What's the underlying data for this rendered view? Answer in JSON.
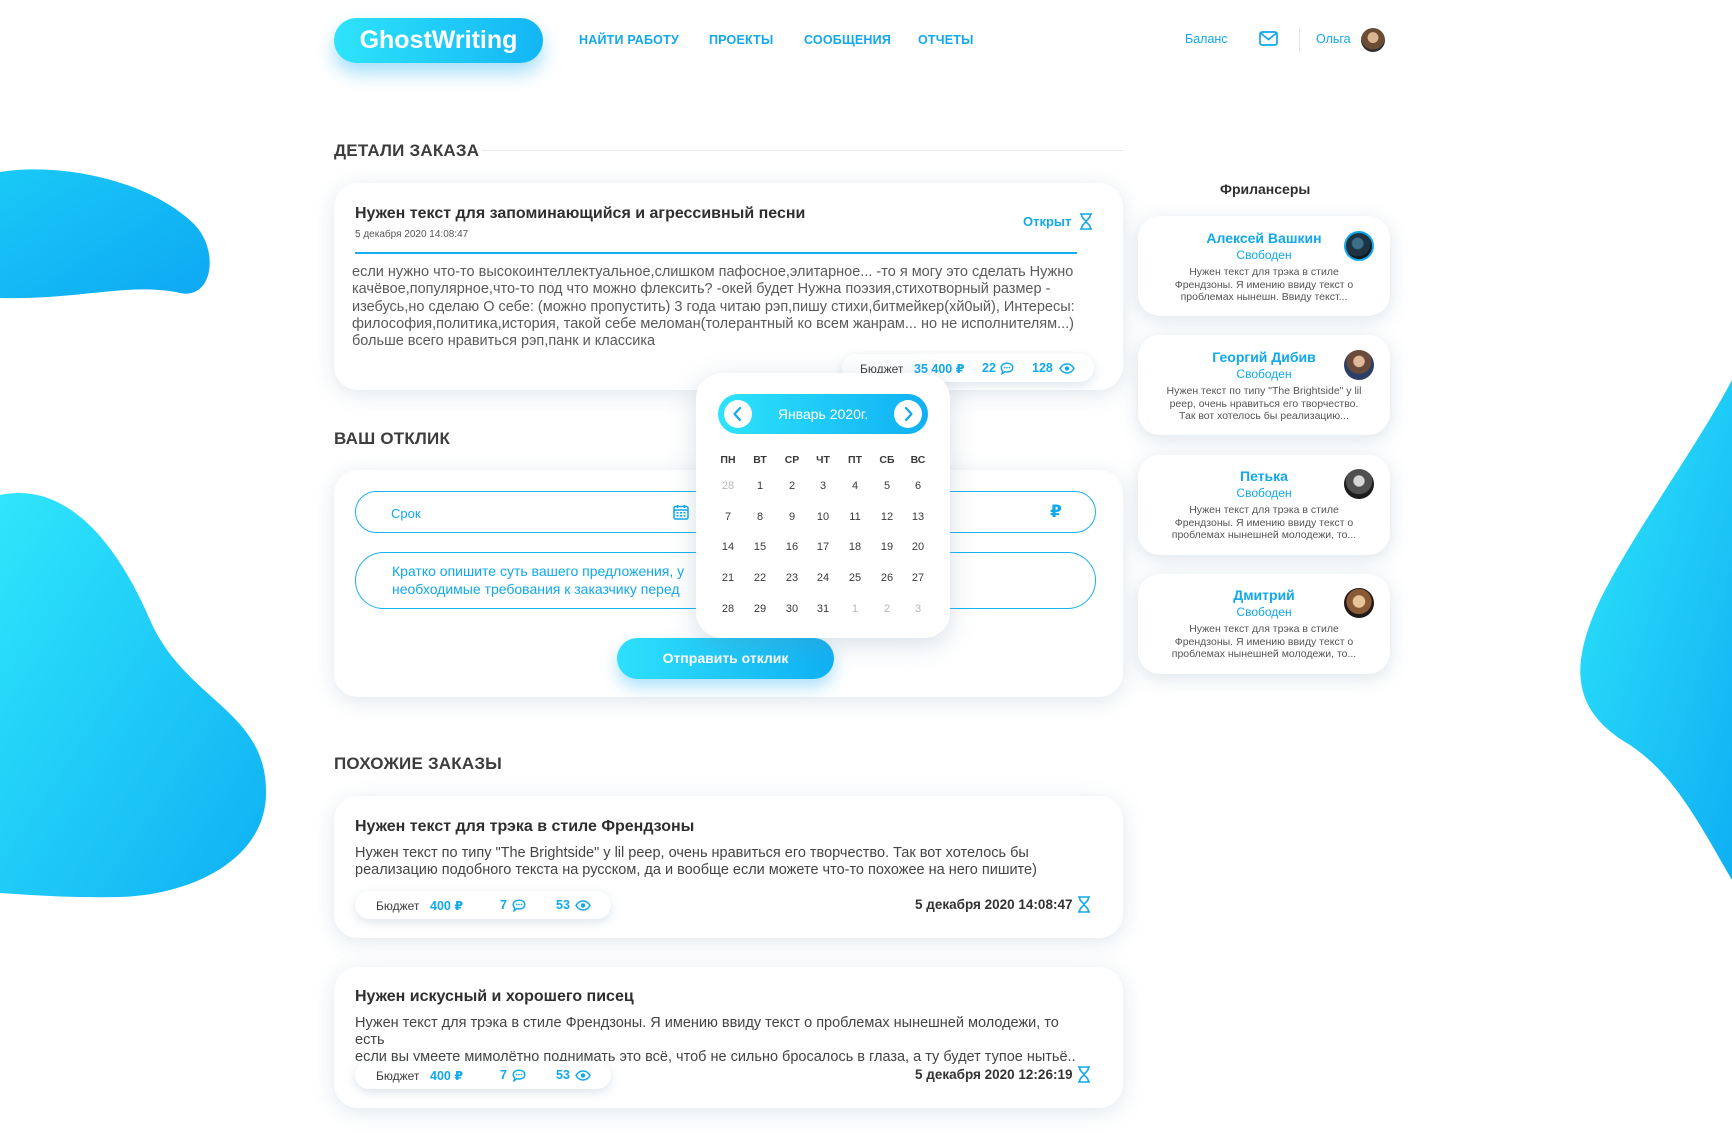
{
  "brand": {
    "name": "GhostWriting"
  },
  "nav": [
    "НАЙТИ РАБОТУ",
    "ПРОЕКТЫ",
    "СООБЩЕНИЯ",
    "ОТЧЕТЫ"
  ],
  "user": {
    "balance_label": "Баланс",
    "name": "Ольга"
  },
  "colors": {
    "accent": "#11a8ec",
    "gradient_start": "#2ee3fb",
    "gradient_end": "#0fb0f3"
  },
  "order": {
    "section_title": "ДЕТАЛИ ЗАКАЗА",
    "title": "Нужен текст для запоминающийся и агрессивный песни",
    "date": "5 декабря 2020 14:08:47",
    "status": "Открыт",
    "description_lines": [
      "если нужно что-то высокоинтеллектуальное,слишком пафосное,элитарное... -то я могу это сделать Нужно",
      "качёвое,популярное,что-то под что можно флексить? -окей будет Нужна поэзия,стихотворный размер -",
      "изебусь,но сделаю О себе: (можно пропустить) 3 года читаю рэп,пишу стихи,битмейкер(хй0ый), Интересы:",
      "философия,политика,история, такой себе меломан(толерантный ко всем жанрам... но не исполнителям...)",
      "больше всего нравиться рэп,панк и классика"
    ],
    "budget_label": "Бюджет",
    "budget": "35 400 ₽",
    "comments": "22",
    "views": "128"
  },
  "response": {
    "section_title": "ВАШ ОТКЛИК",
    "deadline_placeholder": "Срок",
    "currency": "₽",
    "message_lines": [
      "Кратко опишите суть вашего предложения, у",
      "необходимые требования к заказчику перед"
    ],
    "submit": "Отправить отклик"
  },
  "calendar": {
    "month": "Январь 2020г.",
    "weekdays": [
      "ПН",
      "ВТ",
      "СР",
      "ЧТ",
      "ПТ",
      "СБ",
      "ВС"
    ],
    "weeks": [
      [
        "28",
        "1",
        "2",
        "3",
        "4",
        "5",
        "6"
      ],
      [
        "7",
        "8",
        "9",
        "10",
        "11",
        "12",
        "13"
      ],
      [
        "14",
        "15",
        "16",
        "17",
        "18",
        "19",
        "20"
      ],
      [
        "21",
        "22",
        "23",
        "24",
        "25",
        "26",
        "27"
      ],
      [
        "28",
        "29",
        "30",
        "31",
        "1",
        "2",
        "3"
      ]
    ]
  },
  "freelancers": {
    "title": "Фрилансеры",
    "items": [
      {
        "name": "Алексей Вашкин",
        "status": "Свободен",
        "desc_lines": [
          "Нужен текст для трэка в стиле",
          "Френдзоны. Я имению ввиду текст о",
          "проблемах нынешн. Ввиду текст..."
        ]
      },
      {
        "name": "Георгий Дибив",
        "status": "Свободен",
        "desc_lines": [
          "Нужен текст по типу \"The Brightside\" у lil",
          "peep, очень нравиться его творчество.",
          "Так вот хотелось бы реализацию..."
        ]
      },
      {
        "name": "Петька",
        "status": "Свободен",
        "desc_lines": [
          "Нужен текст для трэка в стиле",
          "Френдзоны. Я имению ввиду текст о",
          "проблемах нынешней молодежи, то..."
        ]
      },
      {
        "name": "Дмитрий",
        "status": "Свободен",
        "desc_lines": [
          "Нужен текст для трэка в стиле",
          "Френдзоны. Я имению ввиду текст о",
          "проблемах нынешней молодежи, то..."
        ]
      }
    ]
  },
  "similar": {
    "section_title": "ПОХОЖИЕ ЗАКАЗЫ",
    "items": [
      {
        "title": "Нужен текст для трэка в стиле Френдзоны",
        "desc_lines": [
          "Нужен текст по типу \"The Brightside\" у lil peep, очень нравиться его творчество. Так вот хотелось бы",
          "реализацию подобного текста на русском, да и вообще если можете что-то похожее на него пишите)"
        ],
        "budget_label": "Бюджет",
        "budget": "400 ₽",
        "comments": "7",
        "views": "53",
        "date": "5 декабря 2020 14:08:47"
      },
      {
        "title": "Нужен искусный и хорошего писец",
        "desc_lines": [
          "Нужен текст для трэка в стиле Френдзоны. Я имению ввиду текст о проблемах нынешней молодежи, то есть",
          "если вы умеете мимолётно поднимать это всё, чтоб не сильно бросалось в глаза, а ту будет тупое нытьё.."
        ],
        "budget_label": "Бюджет",
        "budget": "400 ₽",
        "comments": "7",
        "views": "53",
        "date": "5 декабря 2020 12:26:19"
      }
    ]
  }
}
